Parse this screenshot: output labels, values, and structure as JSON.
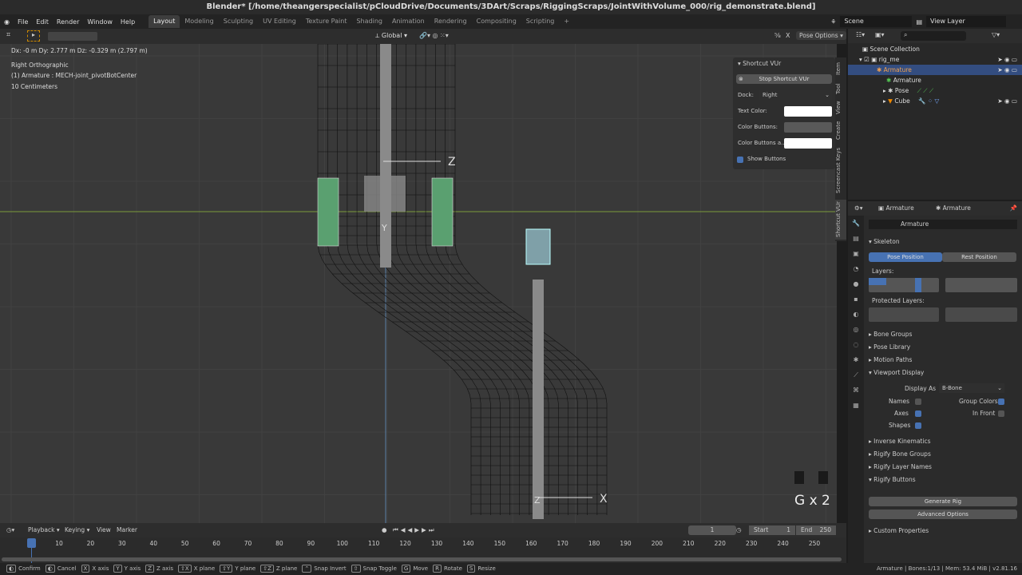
{
  "title": "Blender* [/home/theangerspecialist/pCloudDrive/Documents/3DArt/Scraps/RiggingScraps/JointWithVolume_000/rig_demonstrate.blend]",
  "menu": [
    "File",
    "Edit",
    "Render",
    "Window",
    "Help"
  ],
  "workspaces": [
    "Layout",
    "Modeling",
    "Sculpting",
    "UV Editing",
    "Texture Paint",
    "Shading",
    "Animation",
    "Rendering",
    "Compositing",
    "Scripting",
    "+"
  ],
  "scene": "Scene",
  "view_layer": "View Layer",
  "viewport": {
    "orientation": "Global",
    "pose_options": "Pose Options",
    "x_toggle": "X",
    "delta": "Dx: -0 m  Dy: 2.777 m  Dz: -0.329 m (2.797 m)",
    "view_name": "Right Orthographic",
    "active": "(1) Armature : MECH-joint_pivotBotCenter",
    "scale": "10 Centimeters",
    "keys_display": "G x 2",
    "axis_z": "Z",
    "axis_y": "Y",
    "axis_x": "X"
  },
  "npanel": {
    "title": "Shortcut VUr",
    "stop": "Stop Shortcut VUr",
    "dock_label": "Dock:",
    "dock_value": "Right",
    "text_color": "Text Color:",
    "color_buttons": "Color Buttons:",
    "color_buttons_a": "Color Buttons a...",
    "show_buttons": "Show Buttons",
    "tabs": [
      "Item",
      "Tool",
      "View",
      "Create",
      "Screencast Keys",
      "Shortcut VUr"
    ],
    "text_color_value": "#ffffff",
    "color_buttons_value": "#595959"
  },
  "outliner": {
    "items": [
      "Scene Collection",
      "rig_me",
      "Armature",
      "Armature",
      "Pose",
      "Cube"
    ]
  },
  "properties": {
    "header_left": "Armature",
    "header_right": "Armature",
    "data_name": "Armature",
    "skeleton": "Skeleton",
    "pose_position": "Pose Position",
    "rest_position": "Rest Position",
    "layers": "Layers:",
    "protected_layers": "Protected Layers:",
    "sections": [
      "Bone Groups",
      "Pose Library",
      "Motion Paths",
      "Viewport Display"
    ],
    "display_as_label": "Display As",
    "display_as": "B-Bone",
    "names": "Names",
    "axes": "Axes",
    "shapes": "Shapes",
    "group_colors": "Group Colors",
    "in_front": "In Front",
    "names_checked": false,
    "axes_checked": true,
    "shapes_checked": true,
    "group_colors_checked": true,
    "in_front_checked": false,
    "sections2": [
      "Inverse Kinematics",
      "Rigify Bone Groups",
      "Rigify Layer Names",
      "Rigify Buttons"
    ],
    "generate_rig": "Generate Rig",
    "advanced_options": "Advanced Options",
    "custom_properties": "Custom Properties"
  },
  "timeline": {
    "menus": [
      "Playback",
      "Keying",
      "View",
      "Marker"
    ],
    "current_frame": "1",
    "start_label": "Start",
    "start": "1",
    "end_label": "End",
    "end": "250",
    "ticks": [
      "1",
      "10",
      "20",
      "30",
      "40",
      "50",
      "60",
      "70",
      "80",
      "90",
      "100",
      "110",
      "120",
      "130",
      "140",
      "150",
      "160",
      "170",
      "180",
      "190",
      "200",
      "210",
      "220",
      "230",
      "240",
      "250"
    ]
  },
  "status": {
    "hints": [
      "Confirm",
      "Cancel",
      "X axis",
      "Y axis",
      "Z axis",
      "X plane",
      "Y plane",
      "Z plane",
      "Snap Invert",
      "Snap Toggle",
      "Move",
      "Rotate",
      "Resize"
    ],
    "keys": [
      "",
      "",
      "X",
      "Y",
      "Z",
      "⇧X",
      "⇧Y",
      "⇧Z",
      "⌃",
      "⇧",
      "G",
      "R",
      "S"
    ],
    "info": "Armature | Bones:1/13 | Mem: 53.4 MiB | v2.81.16"
  }
}
